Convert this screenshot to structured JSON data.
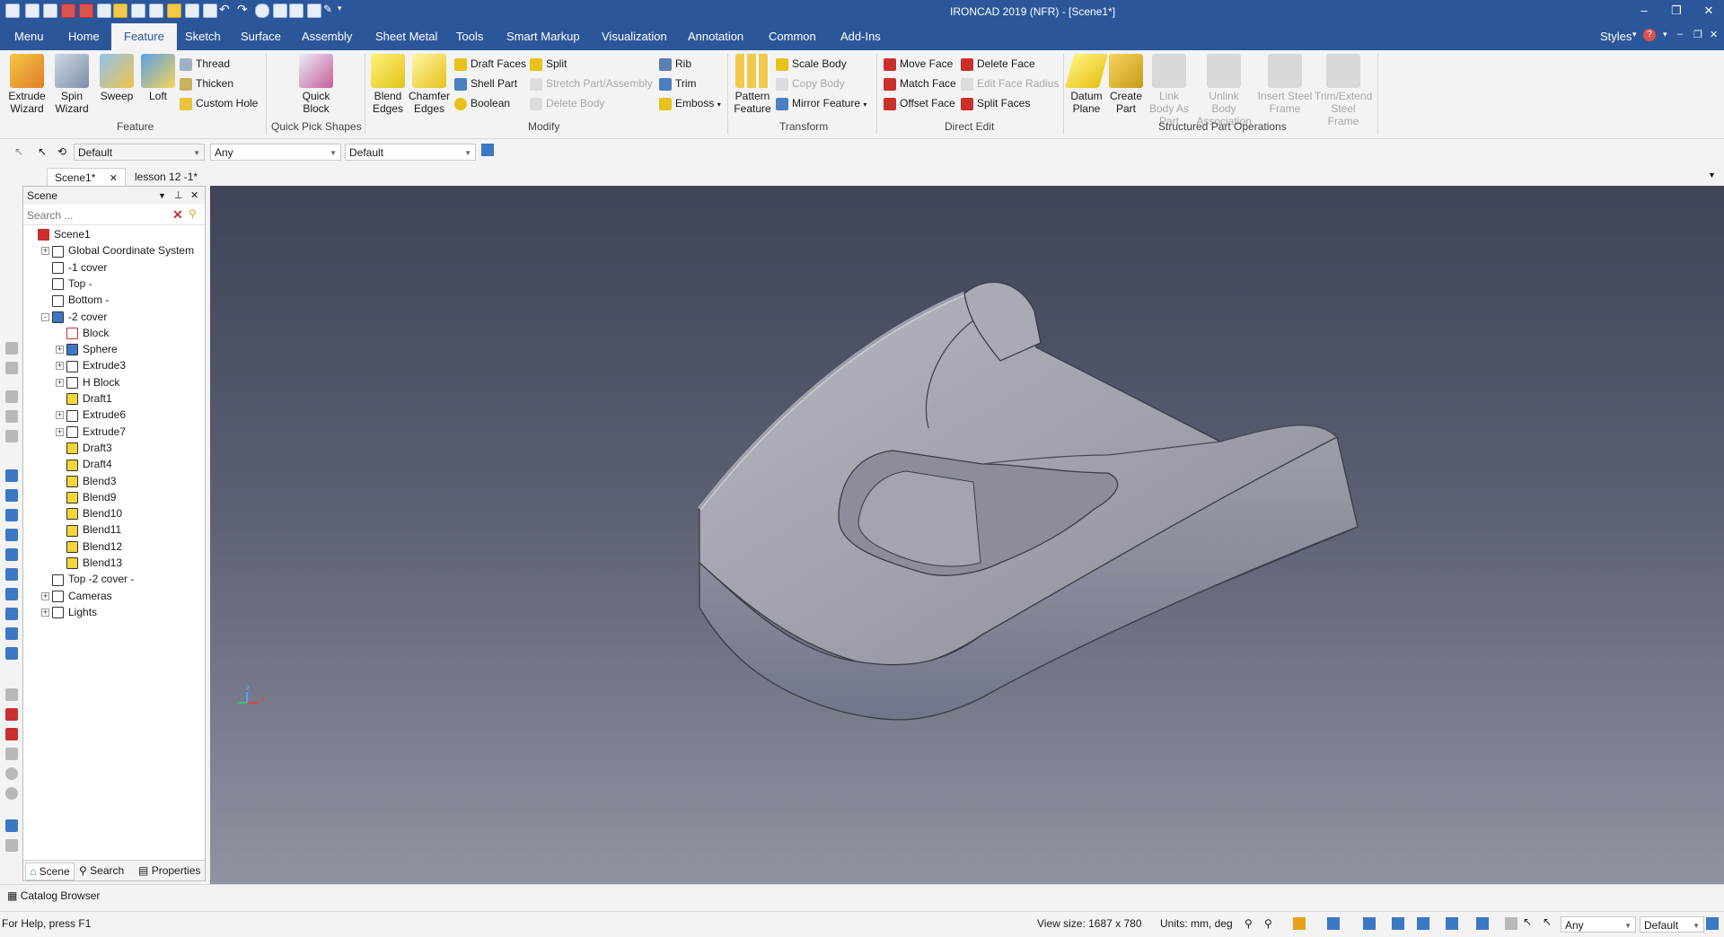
{
  "app": {
    "title": "IRONCAD 2019 (NFR) - [Scene1*]"
  },
  "menubar": {
    "tabs": [
      "Menu",
      "Home",
      "Feature",
      "Sketch",
      "Surface",
      "Assembly",
      "Sheet Metal",
      "Tools",
      "Smart Markup",
      "Visualization",
      "Annotation",
      "Common",
      "Add-Ins"
    ],
    "active": "Feature",
    "styles_label": "Styles"
  },
  "ribbon": {
    "feature": {
      "extrude": "Extrude Wizard",
      "spin": "Spin Wizard",
      "sweep": "Sweep",
      "loft": "Loft",
      "thread": "Thread",
      "thicken": "Thicken",
      "custom_hole": "Custom Hole",
      "group": "Feature"
    },
    "quickpick": {
      "quick_block": "Quick Block",
      "group": "Quick Pick Shapes"
    },
    "modify": {
      "blend": "Blend Edges",
      "chamfer": "Chamfer Edges",
      "draft_faces": "Draft Faces",
      "shell_part": "Shell Part",
      "boolean": "Boolean",
      "split": "Split",
      "stretch": "Stretch Part/Assembly",
      "delete_body": "Delete Body",
      "rib": "Rib",
      "trim": "Trim",
      "emboss": "Emboss",
      "group": "Modify"
    },
    "transform": {
      "pattern": "Pattern Feature",
      "scale_body": "Scale Body",
      "copy_body": "Copy Body",
      "mirror": "Mirror Feature",
      "group": "Transform"
    },
    "directedit": {
      "move_face": "Move Face",
      "match_face": "Match Face",
      "offset_face": "Offset Face",
      "delete_face": "Delete Face",
      "edit_face_radius": "Edit Face Radius",
      "split_faces": "Split Faces",
      "group": "Direct Edit"
    },
    "structured": {
      "datum_plane": "Datum Plane",
      "create_part": "Create Part",
      "link_body": "Link Body As Part",
      "unlink_body": "Unlink Body Association",
      "insert_steel": "Insert Steel Frame",
      "trim_extend": "Trim/Extend Steel Frame",
      "group": "Structured Part Operations"
    }
  },
  "toolrow": {
    "combo1": "Default",
    "combo2": "Any",
    "combo3": "Default"
  },
  "doctabs": [
    "Scene1*",
    "lesson 12 -1*"
  ],
  "scene_panel": {
    "title": "Scene",
    "search_placeholder": "Search ...",
    "tree": [
      {
        "label": "Scene1",
        "level": 0,
        "expander": ""
      },
      {
        "label": "Global Coordinate System",
        "level": 1,
        "expander": "+"
      },
      {
        "label": "-1 cover",
        "level": 1,
        "expander": ""
      },
      {
        "label": "Top -",
        "level": 1,
        "expander": ""
      },
      {
        "label": "Bottom  -",
        "level": 1,
        "expander": ""
      },
      {
        "label": "-2 cover",
        "level": 1,
        "expander": "-"
      },
      {
        "label": "Block",
        "level": 2,
        "expander": ""
      },
      {
        "label": "Sphere",
        "level": 2,
        "expander": "+"
      },
      {
        "label": "Extrude3",
        "level": 2,
        "expander": "+"
      },
      {
        "label": "H Block",
        "level": 2,
        "expander": "+"
      },
      {
        "label": "Draft1",
        "level": 2,
        "expander": ""
      },
      {
        "label": "Extrude6",
        "level": 2,
        "expander": "+"
      },
      {
        "label": "Extrude7",
        "level": 2,
        "expander": "+"
      },
      {
        "label": "Draft3",
        "level": 2,
        "expander": ""
      },
      {
        "label": "Draft4",
        "level": 2,
        "expander": ""
      },
      {
        "label": "Blend3",
        "level": 2,
        "expander": ""
      },
      {
        "label": "Blend9",
        "level": 2,
        "expander": ""
      },
      {
        "label": "Blend10",
        "level": 2,
        "expander": ""
      },
      {
        "label": "Blend11",
        "level": 2,
        "expander": ""
      },
      {
        "label": "Blend12",
        "level": 2,
        "expander": ""
      },
      {
        "label": "Blend13",
        "level": 2,
        "expander": ""
      },
      {
        "label": "Top -2 cover -",
        "level": 1,
        "expander": ""
      },
      {
        "label": "Cameras",
        "level": 1,
        "expander": "+"
      },
      {
        "label": "Lights",
        "level": 1,
        "expander": "+"
      }
    ],
    "bottom_tabs": [
      "Scene",
      "Search",
      "Properties"
    ]
  },
  "catalog": {
    "label": "Catalog Browser"
  },
  "status": {
    "help": "For Help, press F1",
    "view_size": "View size: 1687 x  780",
    "units": "Units: mm, deg",
    "combo_any": "Any",
    "combo_default": "Default"
  },
  "axis": {
    "z": "z",
    "x": "x"
  }
}
